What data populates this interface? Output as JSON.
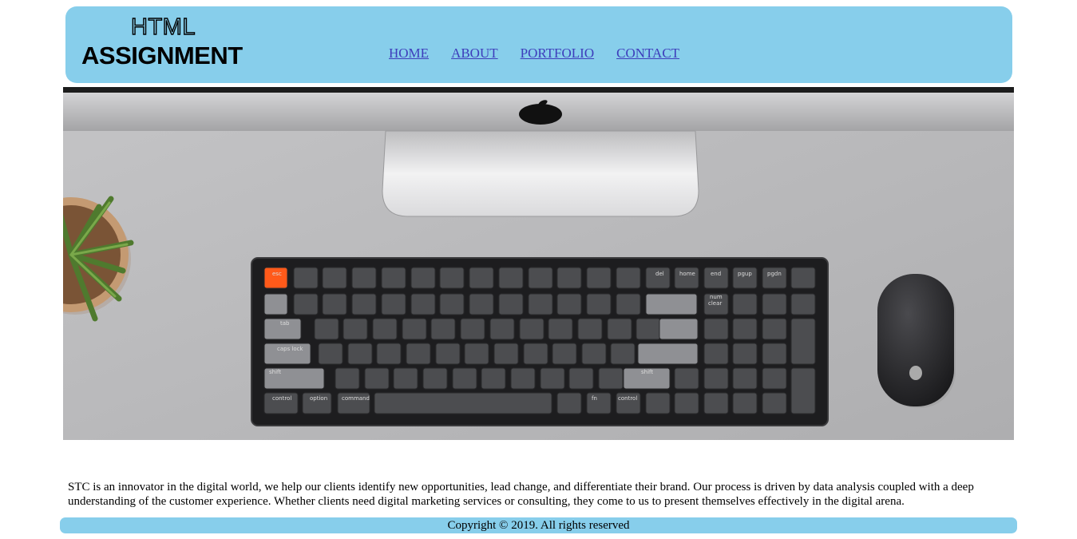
{
  "header": {
    "logo_line1": "HTML",
    "logo_line2": "ASSIGNMENT",
    "nav": [
      "HOME",
      "ABOUT",
      "PORTFOLIO",
      "CONTACT"
    ]
  },
  "hero": {
    "keys": {
      "esc": "esc",
      "del": "del",
      "home": "home",
      "end": "end",
      "pgup": "pgup",
      "pgdn": "pgdn",
      "num": "num",
      "clear": "clear",
      "tab": "tab",
      "caps": "caps lock",
      "shift": "shift",
      "control": "control",
      "option": "option",
      "command": "command",
      "fn": "fn"
    }
  },
  "content": {
    "description": "STC is an innovator in the digital world, we help our clients identify new opportunities, lead change, and differentiate their brand. Our process is driven by data analysis coupled with a deep understanding of the customer experience. Whether clients need digital marketing services or consulting, they come to us to present themselves effectively in the digital arena."
  },
  "footer": {
    "copyright": "Copyright © 2019. All rights reserved"
  },
  "colors": {
    "header_bg": "#87ceeb",
    "nav_link": "#3d3dbb",
    "esc_key": "#ff5a1a"
  }
}
